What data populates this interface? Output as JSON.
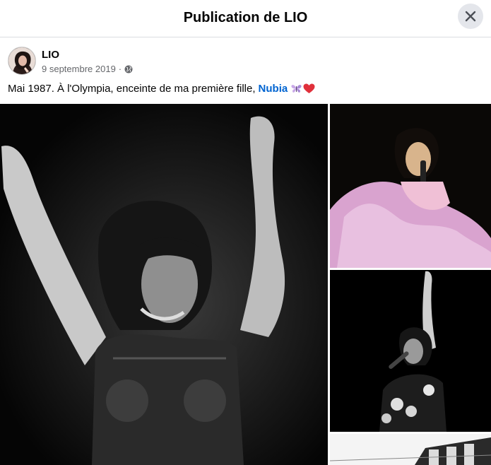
{
  "header": {
    "title": "Publication de LIO"
  },
  "post": {
    "author": "LIO",
    "date": "9 septembre 2019",
    "separator": "·",
    "privacy_icon": "globe-icon",
    "caption_text": "Mai 1987. À l'Olympia, enceinte de ma première fille, ",
    "caption_tag": "Nubia",
    "caption_emojis": [
      "butterfly-emoji",
      "red-heart-emoji"
    ]
  },
  "photos": [
    {
      "name": "photo-main-bw-concert"
    },
    {
      "name": "photo-pink-feathers"
    },
    {
      "name": "photo-bw-microphone"
    },
    {
      "name": "photo-building"
    }
  ],
  "colors": {
    "tag": "#0064d1",
    "meta": "#65676b",
    "close_bg": "#e4e6eb",
    "heart": "#e0303b"
  }
}
